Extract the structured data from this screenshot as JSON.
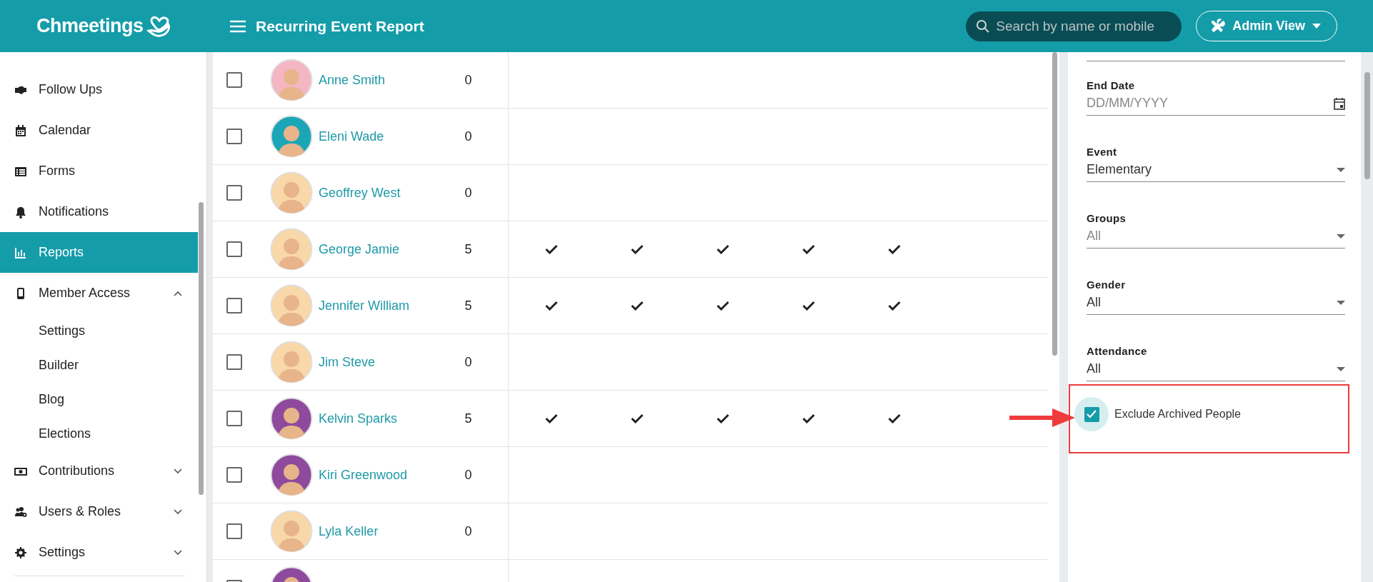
{
  "header": {
    "logo": "Chmeetings",
    "title": "Recurring Event Report",
    "search": {
      "placeholder": "Search by name or mobile"
    },
    "view_button": "Admin View"
  },
  "sidebar": {
    "items": [
      {
        "label": "Follow Ups",
        "selected": false
      },
      {
        "label": "Calendar",
        "selected": false
      },
      {
        "label": "Forms",
        "selected": false
      },
      {
        "label": "Notifications",
        "selected": false
      },
      {
        "label": "Reports",
        "selected": true
      },
      {
        "label": "Member Access",
        "selected": false,
        "expanded": true,
        "children": [
          {
            "label": "Settings",
            "selected": false
          },
          {
            "label": "Builder",
            "selected": false
          },
          {
            "label": "Blog",
            "selected": false
          },
          {
            "label": "Elections",
            "selected": false
          }
        ]
      },
      {
        "label": "Contributions",
        "selected": false,
        "expanded": false
      },
      {
        "label": "Users & Roles",
        "selected": false,
        "expanded": false
      },
      {
        "label": "Settings",
        "selected": false,
        "expanded": false
      }
    ]
  },
  "table": {
    "rows": [
      {
        "checked": false,
        "color": "#f4b6c2",
        "name": "Anne Smith",
        "count": "0",
        "attended": [
          false,
          false,
          false,
          false,
          false
        ]
      },
      {
        "checked": false,
        "color": "#1aa6b7",
        "name": "Eleni Wade",
        "count": "0",
        "attended": [
          false,
          false,
          false,
          false,
          false
        ]
      },
      {
        "checked": false,
        "color": "#f8d7a8",
        "name": "Geoffrey West",
        "count": "0",
        "attended": [
          false,
          false,
          false,
          false,
          false
        ]
      },
      {
        "checked": false,
        "color": "#f8d7a8",
        "name": "George Jamie",
        "count": "5",
        "attended": [
          true,
          true,
          true,
          true,
          true
        ]
      },
      {
        "checked": false,
        "color": "#f8d7a8",
        "name": "Jennifer William",
        "count": "5",
        "attended": [
          true,
          true,
          true,
          true,
          true
        ]
      },
      {
        "checked": false,
        "color": "#f8d7a8",
        "name": "Jim Steve",
        "count": "0",
        "attended": [
          false,
          false,
          false,
          false,
          false
        ]
      },
      {
        "checked": false,
        "color": "#8e4a9d",
        "name": "Kelvin Sparks",
        "count": "5",
        "attended": [
          true,
          true,
          true,
          true,
          true
        ]
      },
      {
        "checked": false,
        "color": "#8e4a9d",
        "name": "Kiri Greenwood",
        "count": "0",
        "attended": [
          false,
          false,
          false,
          false,
          false
        ]
      },
      {
        "checked": false,
        "color": "#f8d7a8",
        "name": "Lyla Keller",
        "count": "0",
        "attended": [
          false,
          false,
          false,
          false,
          false
        ]
      },
      {
        "checked": false,
        "color": "#8e4a9d",
        "attended": [
          false,
          false,
          false,
          false,
          false
        ]
      }
    ]
  },
  "filters": {
    "fields": [
      {
        "kind": "date",
        "label": "End Date",
        "placeholder": "DD/MM/YYYY"
      },
      {
        "kind": "select",
        "label": "Event",
        "value": "Elementary"
      },
      {
        "kind": "select",
        "label": "Groups",
        "placeholder": "All"
      },
      {
        "kind": "select",
        "label": "Gender",
        "value": "All"
      },
      {
        "kind": "select",
        "label": "Attendance",
        "value": "All"
      }
    ],
    "exclude_archived": {
      "label": "Exclude Archived People",
      "checked": true
    }
  }
}
